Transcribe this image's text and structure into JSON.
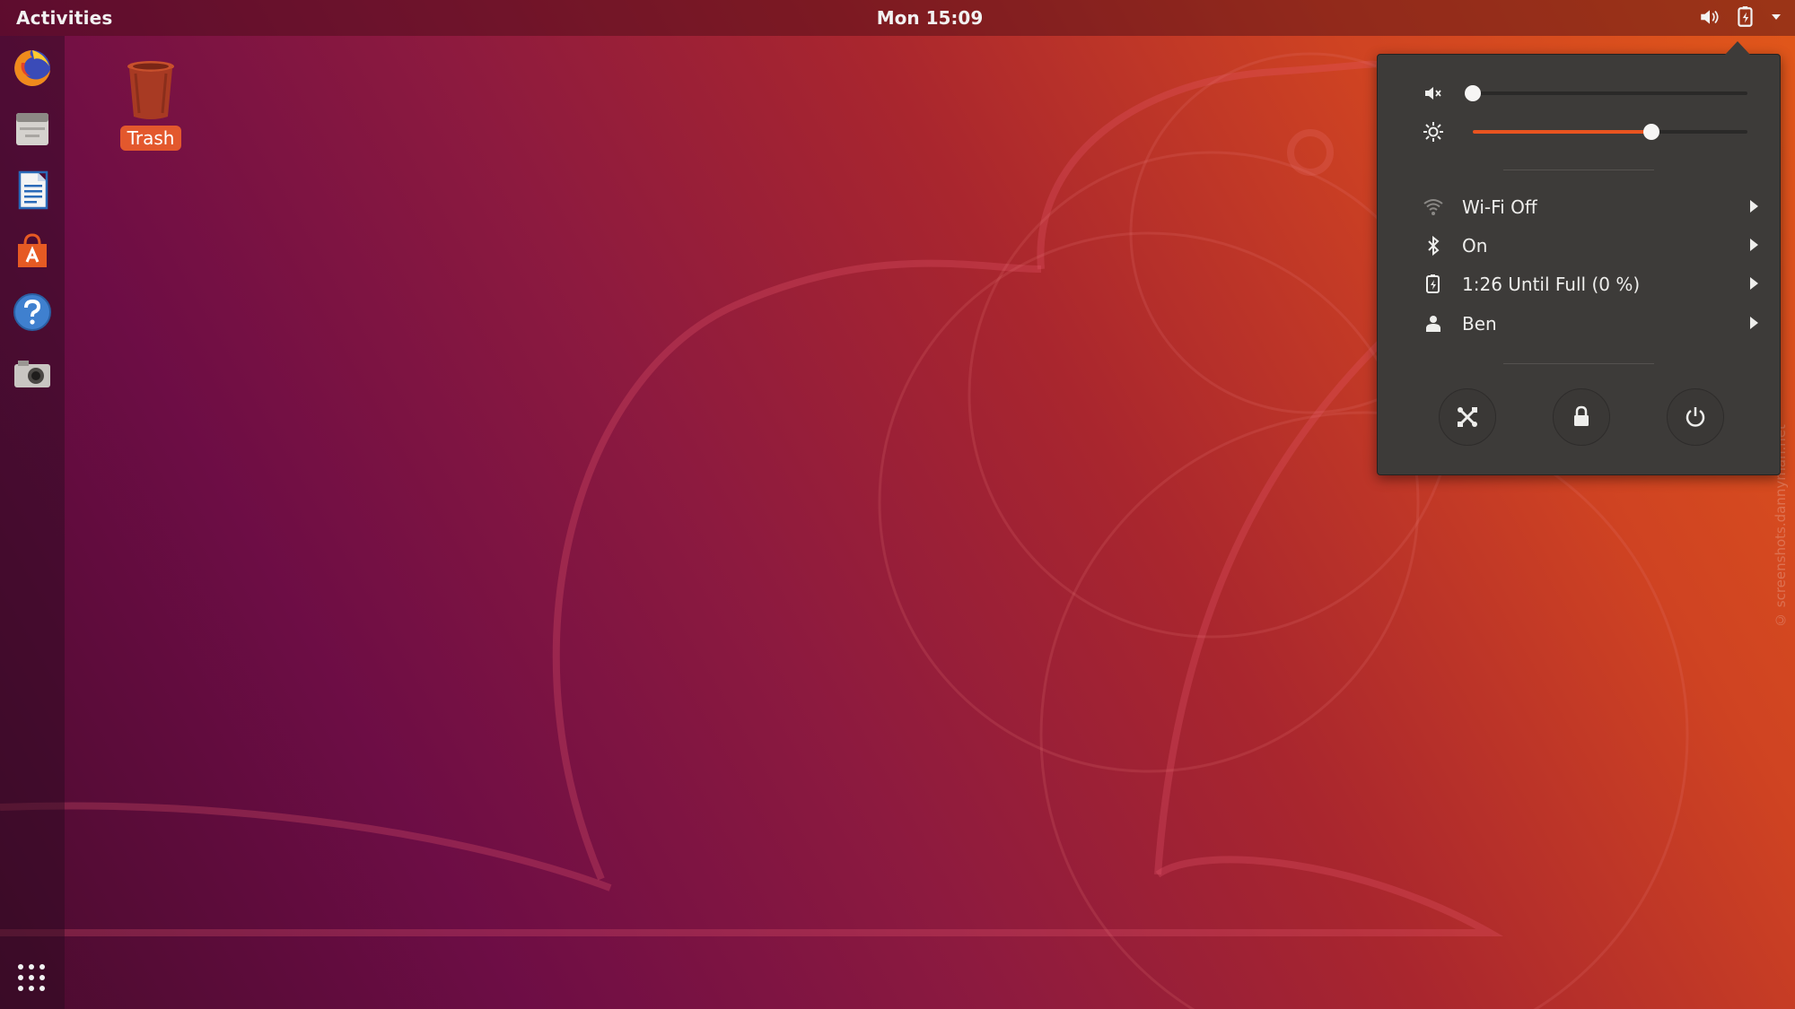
{
  "topbar": {
    "activities_label": "Activities",
    "clock": "Mon 15:09",
    "tray_icons": [
      "speaker-muted-icon",
      "battery-charging-icon",
      "chevron-down-icon"
    ]
  },
  "dock": {
    "items": [
      {
        "name": "firefox",
        "icon": "firefox-icon"
      },
      {
        "name": "files",
        "icon": "files-icon"
      },
      {
        "name": "libreoffice-writer",
        "icon": "writer-icon"
      },
      {
        "name": "ubuntu-software",
        "icon": "software-icon"
      },
      {
        "name": "help",
        "icon": "help-icon"
      },
      {
        "name": "screenshot",
        "icon": "camera-icon"
      }
    ],
    "show_apps_icon": "app-grid-icon"
  },
  "desktop": {
    "trash_label": "Trash"
  },
  "system_menu": {
    "volume": {
      "icon": "speaker-muted-icon",
      "level": 0.0
    },
    "brightness": {
      "icon": "brightness-icon",
      "level": 0.65
    },
    "items": [
      {
        "icon": "wifi-icon",
        "label": "Wi-Fi Off"
      },
      {
        "icon": "bluetooth-icon",
        "label": "On"
      },
      {
        "icon": "battery-charging-icon",
        "label": "1:26 Until Full (0 %)"
      },
      {
        "icon": "user-icon",
        "label": "Ben"
      }
    ],
    "actions": [
      {
        "icon": "settings-tools-icon"
      },
      {
        "icon": "lock-icon"
      },
      {
        "icon": "power-icon"
      }
    ]
  },
  "watermark": "© screenshots.dannyman.net",
  "colors": {
    "accent": "#e95420",
    "menu_bg": "#3d3b39"
  }
}
